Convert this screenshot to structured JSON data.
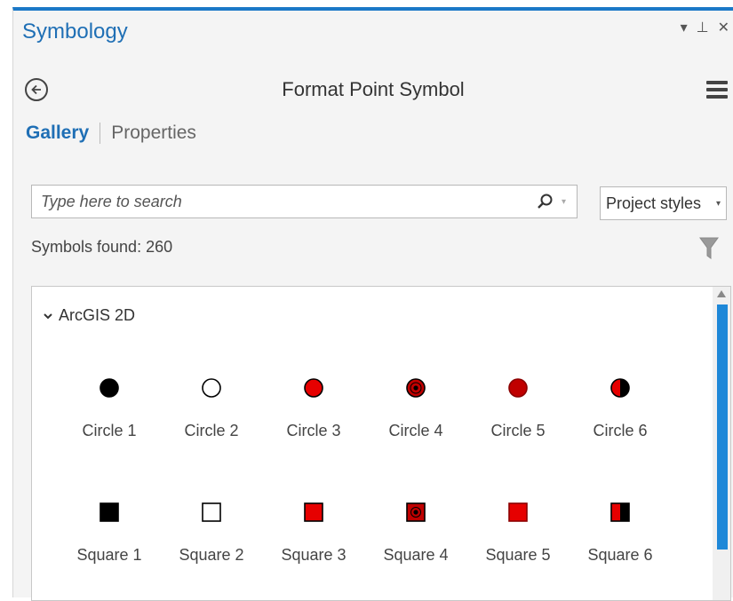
{
  "pane": {
    "title": "Symbology",
    "controls": {
      "dropdown": "▾",
      "pin": "⊥",
      "close": "✕"
    }
  },
  "header": {
    "title": "Format Point Symbol"
  },
  "tabs": [
    {
      "label": "Gallery",
      "active": true
    },
    {
      "label": "Properties",
      "active": false
    }
  ],
  "search": {
    "placeholder": "Type here to search",
    "value": ""
  },
  "style_select": {
    "value": "Project styles"
  },
  "symbols_found": "Symbols found: 260",
  "gallery": {
    "group": "ArcGIS 2D",
    "rows": [
      [
        {
          "label": "Circle 1",
          "shape": "circle",
          "fill": "#000000",
          "stroke": "#000000",
          "inner": null
        },
        {
          "label": "Circle 2",
          "shape": "circle",
          "fill": "#ffffff",
          "stroke": "#000000",
          "inner": null
        },
        {
          "label": "Circle 3",
          "shape": "circle",
          "fill": "#e60000",
          "stroke": "#000000",
          "inner": null
        },
        {
          "label": "Circle 4",
          "shape": "circle",
          "fill": "#c00000",
          "stroke": "#000000",
          "inner": "dot"
        },
        {
          "label": "Circle 5",
          "shape": "circle",
          "fill": "#c00000",
          "stroke": "#8b0000",
          "inner": null
        },
        {
          "label": "Circle 6",
          "shape": "circle",
          "fill": "#e60000",
          "stroke": "#000000",
          "inner": "half-black"
        }
      ],
      [
        {
          "label": "Square 1",
          "shape": "square",
          "fill": "#000000",
          "stroke": "#000000",
          "inner": null
        },
        {
          "label": "Square 2",
          "shape": "square",
          "fill": "#ffffff",
          "stroke": "#000000",
          "inner": null
        },
        {
          "label": "Square 3",
          "shape": "square",
          "fill": "#e60000",
          "stroke": "#000000",
          "inner": null
        },
        {
          "label": "Square 4",
          "shape": "square",
          "fill": "#c00000",
          "stroke": "#000000",
          "inner": "dot"
        },
        {
          "label": "Square 5",
          "shape": "square",
          "fill": "#e60000",
          "stroke": "#8b0000",
          "inner": null
        },
        {
          "label": "Square 6",
          "shape": "square",
          "fill": "#e60000",
          "stroke": "#000000",
          "inner": "half-black"
        }
      ]
    ]
  },
  "colors": {
    "accent": "#1f6fb5",
    "scroll_thumb": "#1e88d8"
  }
}
